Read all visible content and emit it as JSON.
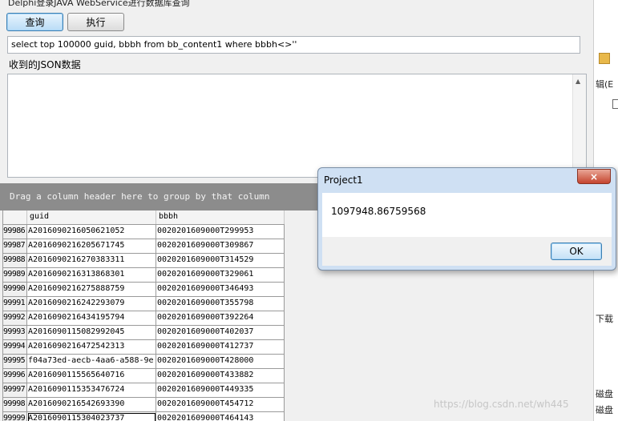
{
  "window": {
    "title": "Delphi登录JAVA WebService进行数据库查询"
  },
  "toolbar": {
    "query_label": "查询",
    "execute_label": "执行"
  },
  "sql": {
    "value": "select top 100000 guid, bbbh from bb_content1 where bbbh<>''"
  },
  "json_section": {
    "label": "收到的JSON数据",
    "value": ""
  },
  "group_panel": {
    "text": "Drag a column header here to group by that column"
  },
  "grid": {
    "columns": [
      "guid",
      "bbbh"
    ],
    "rows": [
      {
        "idx": "99986",
        "guid": "A2016090216050621052",
        "bbbh": "0020201609000T299953"
      },
      {
        "idx": "99987",
        "guid": "A2016090216205671745",
        "bbbh": "0020201609000T309867"
      },
      {
        "idx": "99988",
        "guid": "A2016090216270383311",
        "bbbh": "0020201609000T314529"
      },
      {
        "idx": "99989",
        "guid": "A2016090216313868301",
        "bbbh": "0020201609000T329061"
      },
      {
        "idx": "99990",
        "guid": "A2016090216275888759",
        "bbbh": "0020201609000T346493"
      },
      {
        "idx": "99991",
        "guid": "A2016090216242293079",
        "bbbh": "0020201609000T355798"
      },
      {
        "idx": "99992",
        "guid": "A2016090216434195794",
        "bbbh": "0020201609000T392264"
      },
      {
        "idx": "99993",
        "guid": "A2016090115082992045",
        "bbbh": "0020201609000T402037"
      },
      {
        "idx": "99994",
        "guid": "A2016090216472542313",
        "bbbh": "0020201609000T412737"
      },
      {
        "idx": "99995",
        "guid": "f04a73ed-aecb-4aa6-a588-9e",
        "bbbh": "0020201609000T428000"
      },
      {
        "idx": "99996",
        "guid": "A2016090115565640716",
        "bbbh": "0020201609000T433882"
      },
      {
        "idx": "99997",
        "guid": "A2016090115353476724",
        "bbbh": "0020201609000T449335"
      },
      {
        "idx": "99998",
        "guid": "A2016090216542693390",
        "bbbh": "0020201609000T454712"
      },
      {
        "idx": "99999",
        "guid": "A2016090115304023737",
        "bbbh": "0020201609000T464143"
      }
    ]
  },
  "dialog": {
    "title": "Project1",
    "message": "1097948.86759568",
    "ok_label": "OK",
    "close_icon": "×"
  },
  "background_window": {
    "fragments": [
      "辑(E",
      "下载",
      "磁盘",
      "磁盘"
    ]
  },
  "watermark": {
    "text": "https://blog.csdn.net/wh445"
  },
  "colors": {
    "group_panel_bg": "#8c8c8c",
    "dialog_frame": "#cfe0f3",
    "dialog_close": "#c5442e"
  }
}
